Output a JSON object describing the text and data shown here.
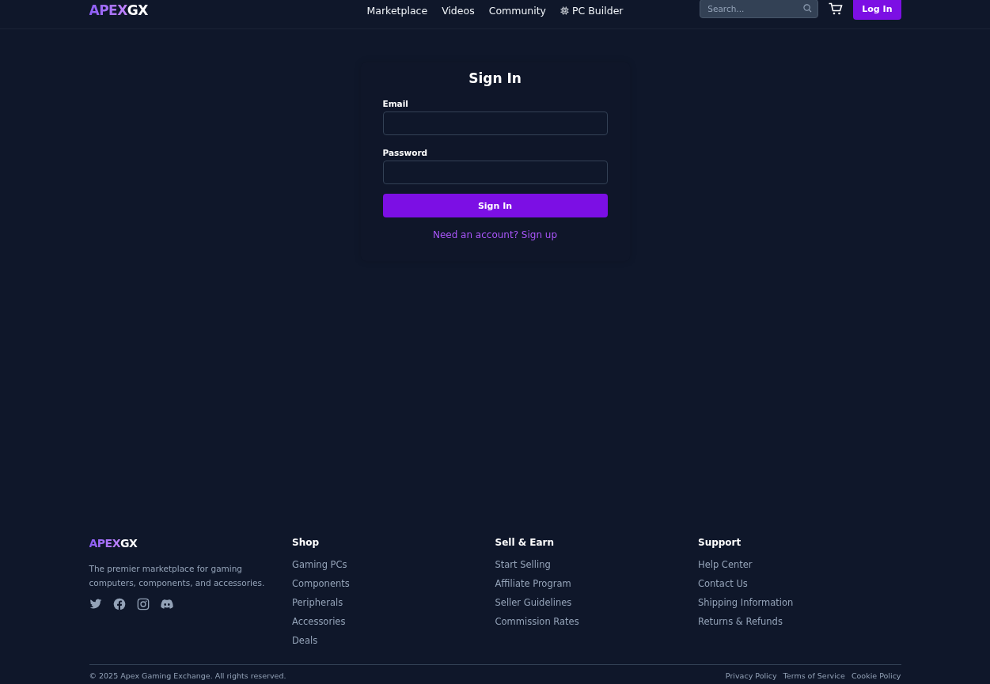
{
  "header": {
    "logo": {
      "accent": "APEX",
      "rest": "GX"
    },
    "nav": [
      {
        "label": "Marketplace",
        "kind": "text"
      },
      {
        "label": "Videos",
        "kind": "text"
      },
      {
        "label": "Community",
        "kind": "text"
      },
      {
        "label": "PC Builder",
        "kind": "chip"
      }
    ],
    "search": {
      "placeholder": "Search..."
    },
    "login_button": "Log In"
  },
  "sign_in": {
    "title": "Sign In",
    "fields": [
      {
        "label": "Email"
      },
      {
        "label": "Password"
      }
    ],
    "submit": "Sign In",
    "signup_link": "Need an account? Sign up"
  },
  "footer": {
    "logo": {
      "accent": "APEX",
      "rest": "GX"
    },
    "tagline": "The premier marketplace for gaming computers, components, and accessories.",
    "social": [
      {
        "kind": "twitter"
      },
      {
        "kind": "facebook"
      },
      {
        "kind": "instagram"
      },
      {
        "kind": "discord"
      }
    ],
    "columns": [
      {
        "title": "Shop",
        "links": [
          "Gaming PCs",
          "Components",
          "Peripherals",
          "Accessories",
          "Deals"
        ]
      },
      {
        "title": "Sell & Earn",
        "links": [
          "Start Selling",
          "Affiliate Program",
          "Seller Guidelines",
          "Commission Rates"
        ]
      },
      {
        "title": "Support",
        "links": [
          "Help Center",
          "Contact Us",
          "Shipping Information",
          "Returns & Refunds"
        ]
      }
    ],
    "copyright": "© 2025 Apex Gaming Exchange. All rights reserved.",
    "legal_links": [
      "Privacy Policy",
      "Terms of Service",
      "Cookie Policy"
    ]
  }
}
